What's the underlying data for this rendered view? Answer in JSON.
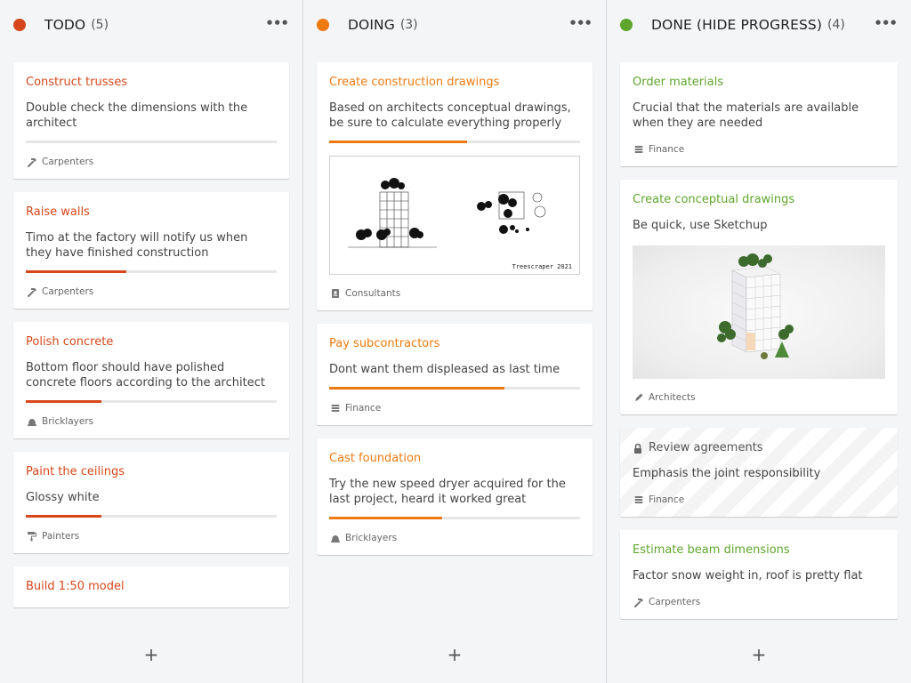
{
  "columns": [
    {
      "title": "TODO",
      "count": "(5)",
      "color": "#d6471b",
      "cards": [
        {
          "title": "Construct trusses",
          "desc": "Double check the dimensions with the architect",
          "progress": 0,
          "tag": "Carpenters",
          "tag_icon": "hammer-icon"
        },
        {
          "title": "Raise walls",
          "desc": "Timo at the factory will notify us when they have finished construction",
          "progress": 0.4,
          "tag": "Carpenters",
          "tag_icon": "hammer-icon"
        },
        {
          "title": "Polish concrete",
          "desc": "Bottom floor should have polished concrete floors according to the architect",
          "progress": 0.3,
          "tag": "Bricklayers",
          "tag_icon": "hardhat-icon"
        },
        {
          "title": "Paint the ceilings",
          "desc": "Glossy white",
          "progress": 0.3,
          "tag": "Painters",
          "tag_icon": "paint-roller-icon"
        },
        {
          "title": "Build 1:50 model"
        }
      ]
    },
    {
      "title": "DOING",
      "count": "(3)",
      "color": "#ee7a0f",
      "cards": [
        {
          "title": "Create construction drawings",
          "desc": "Based on architects conceptual drawings, be sure to calculate everything properly",
          "progress": 0.55,
          "image_caption": "Treescraper 2021",
          "tag": "Consultants",
          "tag_icon": "contact-card-icon"
        },
        {
          "title": "Pay subcontractors",
          "desc": "Dont want them displeased as last time",
          "progress": 0.7,
          "tag": "Finance",
          "tag_icon": "coins-icon"
        },
        {
          "title": "Cast foundation",
          "desc": "Try the new speed dryer acquired for the last project, heard it worked great",
          "progress": 0.45,
          "tag": "Bricklayers",
          "tag_icon": "hardhat-icon"
        }
      ]
    },
    {
      "title": "DONE (HIDE PROGRESS)",
      "count": "(4)",
      "color": "#5fa52c",
      "cards": [
        {
          "title": "Order materials",
          "desc": "Crucial that the materials are available when they are needed",
          "tag": "Finance",
          "tag_icon": "coins-icon"
        },
        {
          "title": "Create conceptual drawings",
          "desc": "Be quick, use Sketchup",
          "tag": "Architects",
          "tag_icon": "pencil-icon"
        },
        {
          "title": "Review agreements",
          "desc": "Emphasis the joint responsibility",
          "tag": "Finance",
          "tag_icon": "coins-icon",
          "locked": true
        },
        {
          "title": "Estimate beam dimensions",
          "desc": "Factor snow weight in, roof is pretty flat",
          "tag": "Carpenters",
          "tag_icon": "hammer-icon"
        }
      ]
    }
  ],
  "add_label": "+",
  "more_label": "•••"
}
